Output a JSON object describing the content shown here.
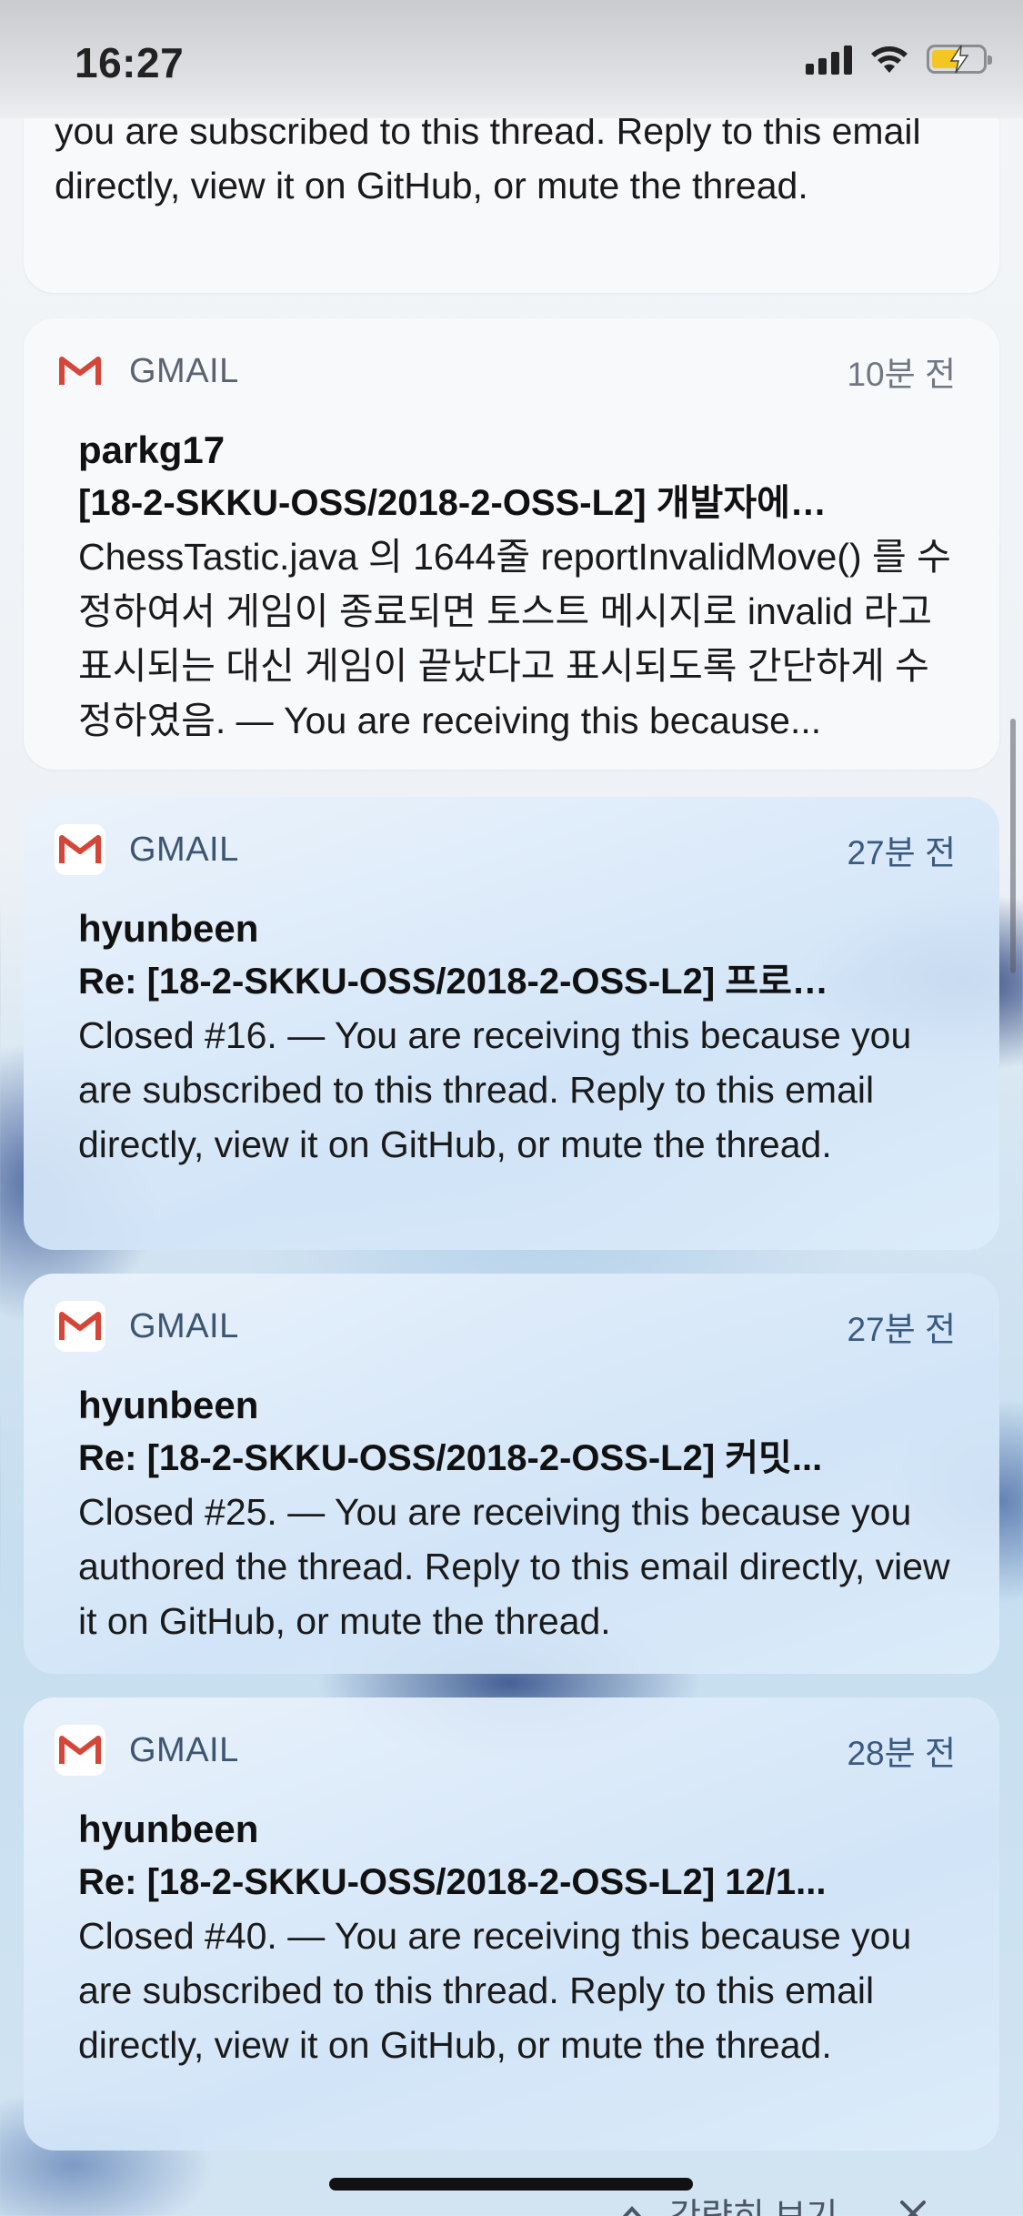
{
  "status_bar": {
    "time": "16:27"
  },
  "partial_notification": {
    "text": "you are subscribed to this thread. Reply to this email directly, view it on GitHub, or mute the thread."
  },
  "notifications": [
    {
      "app": "GMAIL",
      "time_ago": "10분 전",
      "sender": "parkg17",
      "subject": "[18-2-SKKU-OSS/2018-2-OSS-L2] 개발자에…",
      "preview": "ChessTastic.java 의 1644줄 reportInvalidMove() 를 수정하여서 게임이 종료되면 토스트 메시지로 invalid 라고 표시되는 대신 게임이 끝났다고 표시되도록 간단하게 수정하였음. — You are receiving this because..."
    },
    {
      "app": "GMAIL",
      "time_ago": "27분 전",
      "sender": "hyunbeen",
      "subject": "Re: [18-2-SKKU-OSS/2018-2-OSS-L2] 프로…",
      "preview": "Closed #16. — You are receiving this because you are subscribed to this thread. Reply to this email directly, view it on GitHub, or mute the thread."
    },
    {
      "app": "GMAIL",
      "time_ago": "27분 전",
      "sender": "hyunbeen",
      "subject": "Re: [18-2-SKKU-OSS/2018-2-OSS-L2] 커밋...",
      "preview": "Closed #25. — You are receiving this because you authored the thread. Reply to this email directly, view it on GitHub, or mute the thread."
    },
    {
      "app": "GMAIL",
      "time_ago": "28분 전",
      "sender": "hyunbeen",
      "subject": "Re: [18-2-SKKU-OSS/2018-2-OSS-L2] 12/1...",
      "preview": "Closed #40. — You are receiving this because you are subscribed to this thread. Reply to this email directly, view it on GitHub, or mute the thread."
    }
  ],
  "footer": {
    "show_less_label": "간략히 보기"
  },
  "colors": {
    "gmail_red": "#d44638",
    "battery_yellow": "#f3c623"
  },
  "icons": [
    "gmail-icon",
    "signal-icon",
    "wifi-icon",
    "battery-icon",
    "chevron-up-icon",
    "close-icon"
  ]
}
